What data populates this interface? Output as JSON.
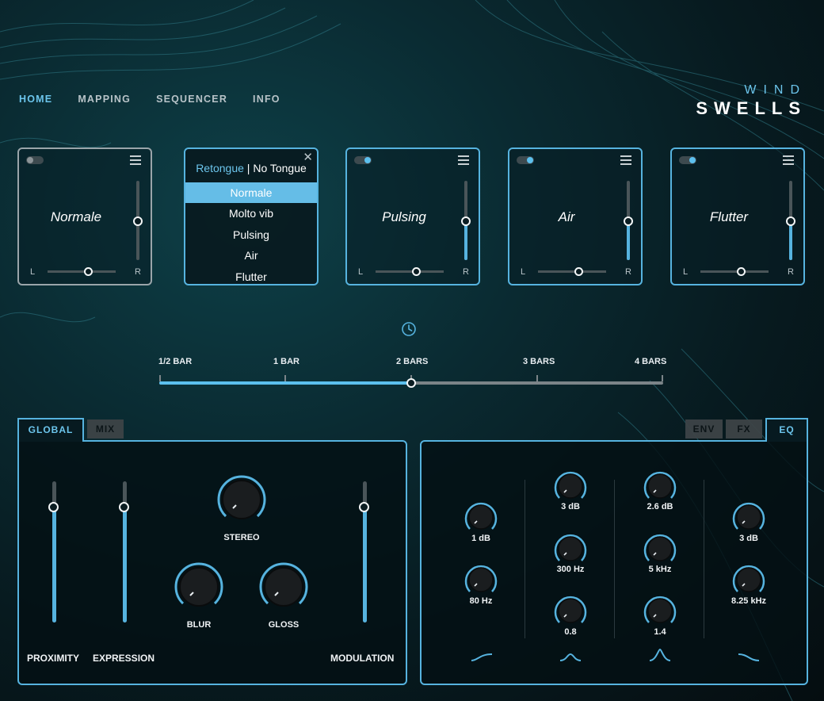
{
  "nav": {
    "home": "HOME",
    "mapping": "MAPPING",
    "sequencer": "SEQUENCER",
    "info": "INFO",
    "active": "HOME"
  },
  "brand": {
    "line1": "WIND",
    "line2": "SWELLS"
  },
  "accent_color": "#56b3df",
  "slots": [
    {
      "name": "Normale",
      "enabled": false,
      "volume": 0.5,
      "pan": 0.5
    },
    {
      "name": "Pulsing",
      "enabled": true,
      "volume": 0.5,
      "pan": 0.5
    },
    {
      "name": "Air",
      "enabled": true,
      "volume": 0.5,
      "pan": 0.5
    },
    {
      "name": "Flutter",
      "enabled": true,
      "volume": 0.5,
      "pan": 0.5
    }
  ],
  "slot_labels": {
    "left": "L",
    "right": "R"
  },
  "dropdown": {
    "header_selected": "Retongue",
    "header_sep": " | ",
    "header_other": "No Tongue",
    "close": "✕",
    "items": [
      "Normale",
      "Molto vib",
      "Pulsing",
      "Air",
      "Flutter"
    ],
    "selected": "Normale"
  },
  "tempo": {
    "labels": [
      "1/2 BAR",
      "1 BAR",
      "2 BARS",
      "3 BARS",
      "4 BARS"
    ],
    "value": "2 BARS"
  },
  "left_tabs": {
    "global": "GLOBAL",
    "mix": "MIX",
    "active": "GLOBAL"
  },
  "right_tabs": {
    "env": "ENV",
    "fx": "FX",
    "eq": "EQ",
    "active": "EQ"
  },
  "global": {
    "proximity": {
      "label": "PROXIMITY",
      "value": 0.82
    },
    "expression": {
      "label": "EXPRESSION",
      "value": 0.82
    },
    "modulation": {
      "label": "MODULATION",
      "value": 0.82
    },
    "stereo": {
      "label": "STEREO"
    },
    "blur": {
      "label": "BLUR"
    },
    "gloss": {
      "label": "GLOSS"
    }
  },
  "eq": {
    "band1": {
      "gain": "1 dB",
      "freq": "80 Hz"
    },
    "band2": {
      "gain": "3 dB",
      "freq": "300 Hz",
      "q": "0.8"
    },
    "band3": {
      "gain": "2.6 dB",
      "freq": "5 kHz",
      "q": "1.4"
    },
    "band4": {
      "gain": "3 dB",
      "freq": "8.25 kHz"
    },
    "shapes": [
      "low-shelf-icon",
      "bell-icon",
      "peak-icon",
      "high-shelf-icon"
    ]
  }
}
